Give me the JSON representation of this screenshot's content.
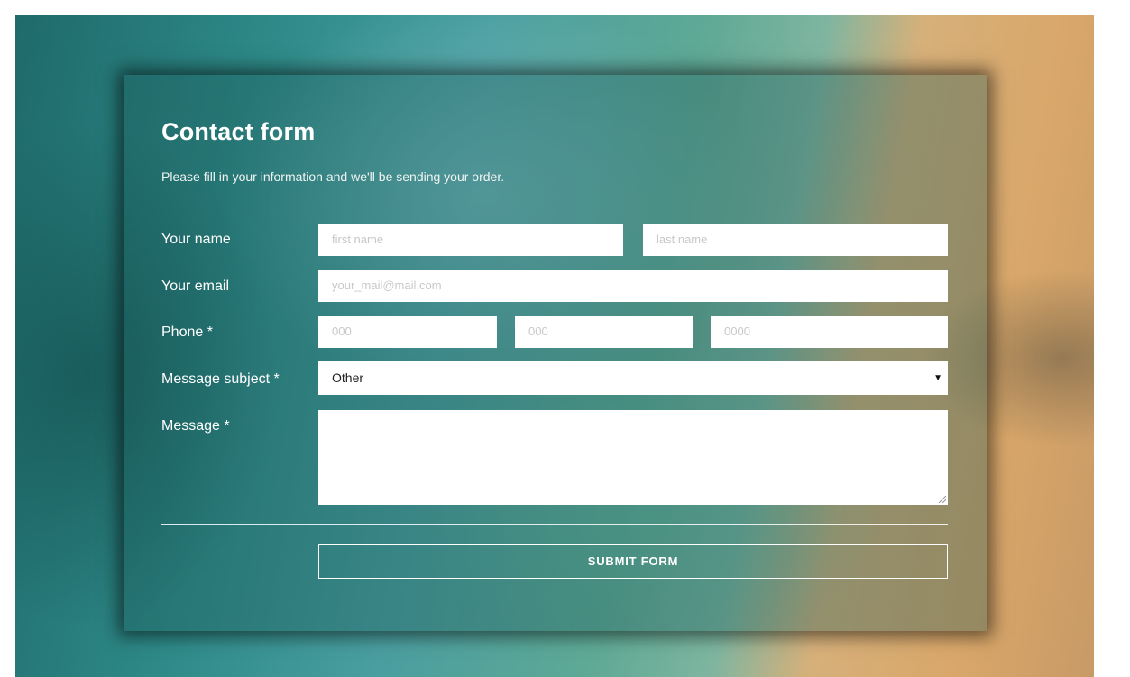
{
  "form": {
    "title": "Contact form",
    "subtitle": "Please fill in your information and we'll be sending your order.",
    "name": {
      "label": "Your name",
      "first_placeholder": "first name",
      "last_placeholder": "last name"
    },
    "email": {
      "label": "Your email",
      "placeholder": "your_mail@mail.com"
    },
    "phone": {
      "label": "Phone *",
      "part1_placeholder": "000",
      "part2_placeholder": "000",
      "part3_placeholder": "0000"
    },
    "subject": {
      "label": "Message subject *",
      "selected": "Other",
      "caret_icon": "▼"
    },
    "message": {
      "label": "Message *",
      "value": ""
    },
    "submit_label": "SUBMIT FORM"
  }
}
